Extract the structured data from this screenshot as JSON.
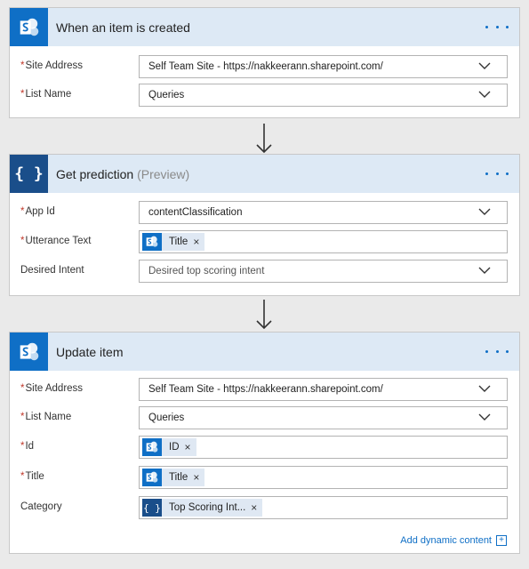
{
  "colors": {
    "sharepoint_blue": "#0f6fc6",
    "luis_blue": "#1a4e8a",
    "header_bg": "#dde9f5",
    "required": "#c0392b",
    "link": "#0f6fc6"
  },
  "step1": {
    "icon": "sharepoint-icon",
    "title": "When an item is created",
    "site_address": {
      "label": "Site Address",
      "required": true,
      "value": "Self Team Site - https://nakkeerann.sharepoint.com/"
    },
    "list_name": {
      "label": "List Name",
      "required": true,
      "value": "Queries"
    }
  },
  "step2": {
    "icon": "braces-icon",
    "title": "Get prediction",
    "title_suffix": "(Preview)",
    "app_id": {
      "label": "App Id",
      "required": true,
      "value": "contentClassification"
    },
    "utterance": {
      "label": "Utterance Text",
      "required": true,
      "token": "Title"
    },
    "desired_intent": {
      "label": "Desired Intent",
      "required": false,
      "placeholder": "Desired top scoring intent"
    }
  },
  "step3": {
    "icon": "sharepoint-icon",
    "title": "Update item",
    "site_address": {
      "label": "Site Address",
      "required": true,
      "value": "Self Team Site - https://nakkeerann.sharepoint.com/"
    },
    "list_name": {
      "label": "List Name",
      "required": true,
      "value": "Queries"
    },
    "id": {
      "label": "Id",
      "required": true,
      "token": "ID"
    },
    "title_field": {
      "label": "Title",
      "required": true,
      "token": "Title"
    },
    "category": {
      "label": "Category",
      "required": false,
      "token": "Top Scoring Int..."
    },
    "add_dynamic": "Add dynamic content",
    "add_dynamic_plus": "+"
  },
  "glyphs": {
    "req": "*",
    "remove": "×",
    "more": "...",
    "braces": "{ }"
  }
}
